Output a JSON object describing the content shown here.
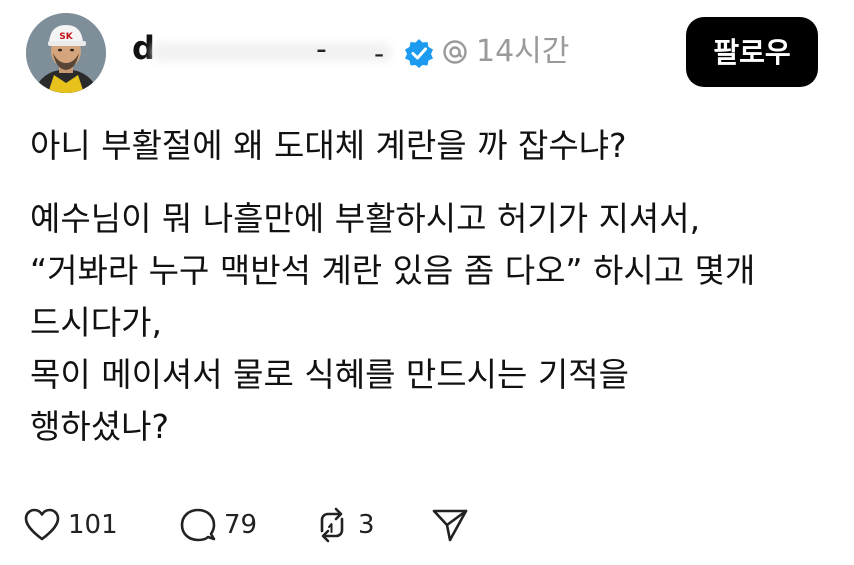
{
  "header": {
    "username_fragment": "d",
    "username_dot1": "-",
    "username_dot2": "-",
    "time": "14시간",
    "follow_label": "팔로우",
    "avatar_badge": "SK",
    "verified_color": "#1d9bf0"
  },
  "post": {
    "paragraph1": "아니 부활절에 왜 도대체 계란을 까 잡수냐?",
    "paragraph2_lines": [
      "예수님이 뭐 나흘만에 부활하시고 허기가 지셔서,",
      "“거봐라 누구 맥반석 계란 있음 좀 다오” 하시고 몇개",
      "드시다가,",
      "목이 메이셔서 물로 식혜를 만드시는 기적을",
      "행하셨나?"
    ]
  },
  "actions": {
    "likes": "101",
    "comments": "79",
    "reposts": "3",
    "icons": [
      "heart-icon",
      "comment-icon",
      "repost-icon",
      "share-icon"
    ]
  }
}
